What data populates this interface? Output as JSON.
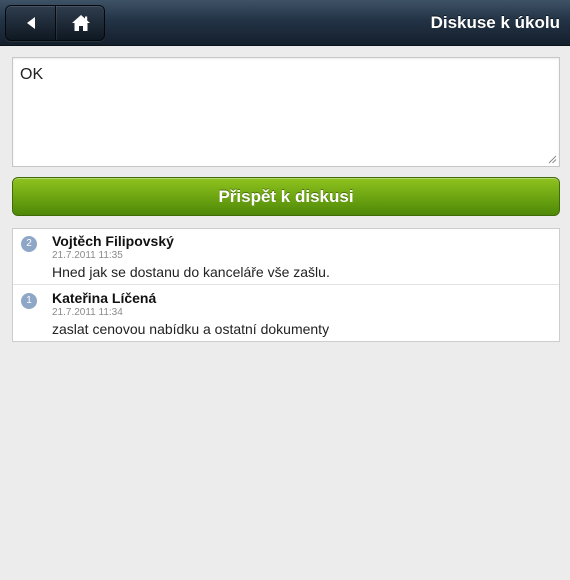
{
  "header": {
    "title": "Diskuse k úkolu",
    "back_icon": "back-arrow-icon",
    "home_icon": "home-icon"
  },
  "comment": {
    "value": "OK",
    "placeholder": ""
  },
  "submit": {
    "label": "Přispět k diskusi"
  },
  "discussion": {
    "items": [
      {
        "number": "2",
        "author": "Vojtěch Filipovský",
        "date": "21.7.2011 11:35",
        "text": "Hned jak se dostanu do kanceláře vše zašlu."
      },
      {
        "number": "1",
        "author": "Kateřina Líčená",
        "date": "21.7.2011 11:34",
        "text": "zaslat cenovou nabídku a ostatní dokumenty"
      }
    ]
  },
  "colors": {
    "header": "#233346",
    "button": "#6ea612",
    "badge": "#8fa7c7",
    "background": "#ececec"
  }
}
